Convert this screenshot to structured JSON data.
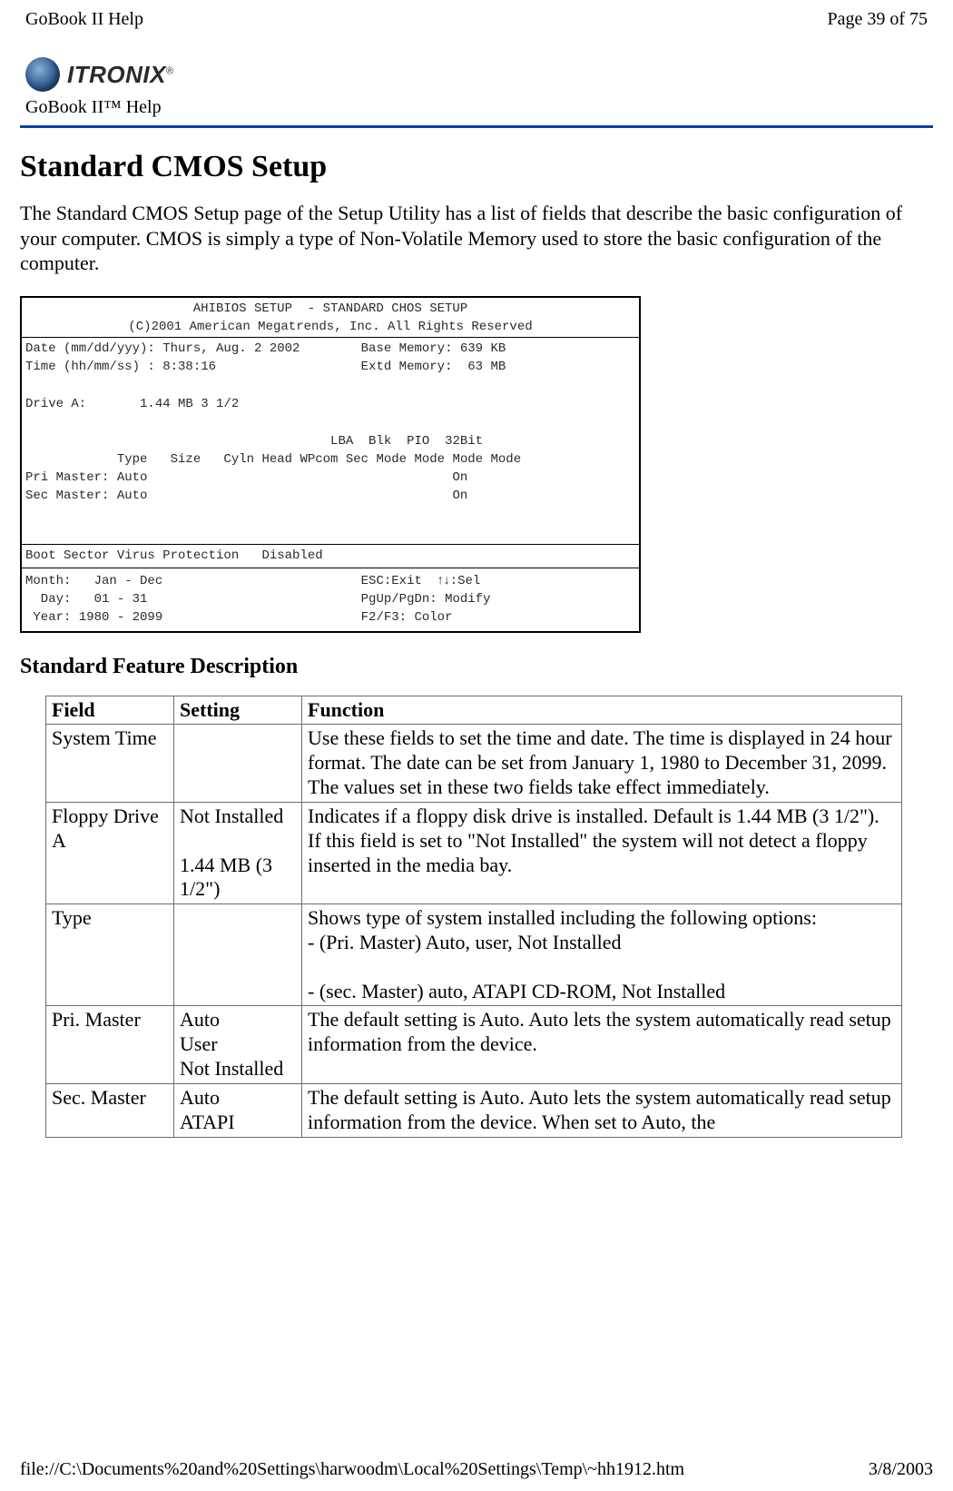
{
  "topbar": {
    "title": "GoBook II Help",
    "page_info": "Page 39 of 75"
  },
  "brand": {
    "logo_text": "ITRONIX",
    "logo_reg": "®",
    "subtitle": "GoBook II™ Help"
  },
  "heading": "Standard CMOS Setup",
  "intro": "The Standard CMOS Setup page of the Setup Utility has a list of fields that describe the basic configuration of your computer.  CMOS is simply a type of Non-Volatile Memory used to store the basic configuration of the computer.",
  "bios": {
    "header_l1": "AHIBIOS SETUP  - STANDARD CHOS SETUP",
    "header_l2": "(C)2001 American Megatrends, Inc. All Rights Reserved",
    "b1_l1": "Date (mm/dd/yyy): Thurs, Aug. 2 2002        Base Memory: 639 KB",
    "b1_l2": "Time (hh/mm/ss) : 8:38:16                   Extd Memory:  63 MB",
    "b1_l3": "",
    "b1_l4": "Drive A:       1.44 MB 3 1/2",
    "b1_l5": "",
    "b1_l6": "                                        LBA  Blk  PIO  32Bit",
    "b1_l7": "            Type   Size   Cyln Head WPcom Sec Mode Mode Mode Mode",
    "b1_l8": "Pri Master: Auto                                        On",
    "b1_l9": "Sec Master: Auto                                        On",
    "b2_l1": "Boot Sector Virus Protection   Disabled",
    "b3_l1": "Month:   Jan - Dec                          ESC:Exit  ",
    "b3_sel": "↑↓",
    "b3_l1b": ":Sel",
    "b3_l2": "  Day:   01 - 31                            PgUp/PgDn: Modify",
    "b3_l3": " Year: 1980 - 2099                          F2/F3: Color"
  },
  "subheading": "Standard Feature Description",
  "table": {
    "headers": {
      "c1": "Field",
      "c2": "Setting",
      "c3": "Function"
    },
    "rows": [
      {
        "field": "System Time",
        "setting": "",
        "function": "Use these fields to set the time and date.  The time is displayed in 24 hour format.  The date can be set from January 1, 1980 to December 31, 2099.  The values set in these two fields take effect immediately."
      },
      {
        "field": "Floppy Drive A",
        "setting": "Not Installed\n\n1.44 MB (3 1/2\")",
        "function": "Indicates if a floppy disk drive is installed.  Default is 1.44 MB (3 1/2\").  If this field is set to \"Not Installed\" the system will not detect a floppy inserted in the media bay."
      },
      {
        "field": "Type",
        "setting": "",
        "function": "Shows type of system installed including the following options:\n- (Pri. Master) Auto, user, Not Installed\n\n- (sec. Master) auto, ATAPI CD-ROM, Not Installed"
      },
      {
        "field": "Pri. Master",
        "setting": "Auto\nUser\nNot Installed",
        "function": "The default setting is Auto.  Auto lets the system automatically read setup information from the device."
      },
      {
        "field": "Sec. Master",
        "setting": "Auto\nATAPI",
        "function": "The default setting is Auto.  Auto lets the system automatically read setup information from the device.  When set to Auto, the"
      }
    ]
  },
  "footer": {
    "path": "file://C:\\Documents%20and%20Settings\\harwoodm\\Local%20Settings\\Temp\\~hh1912.htm",
    "date": "3/8/2003"
  }
}
